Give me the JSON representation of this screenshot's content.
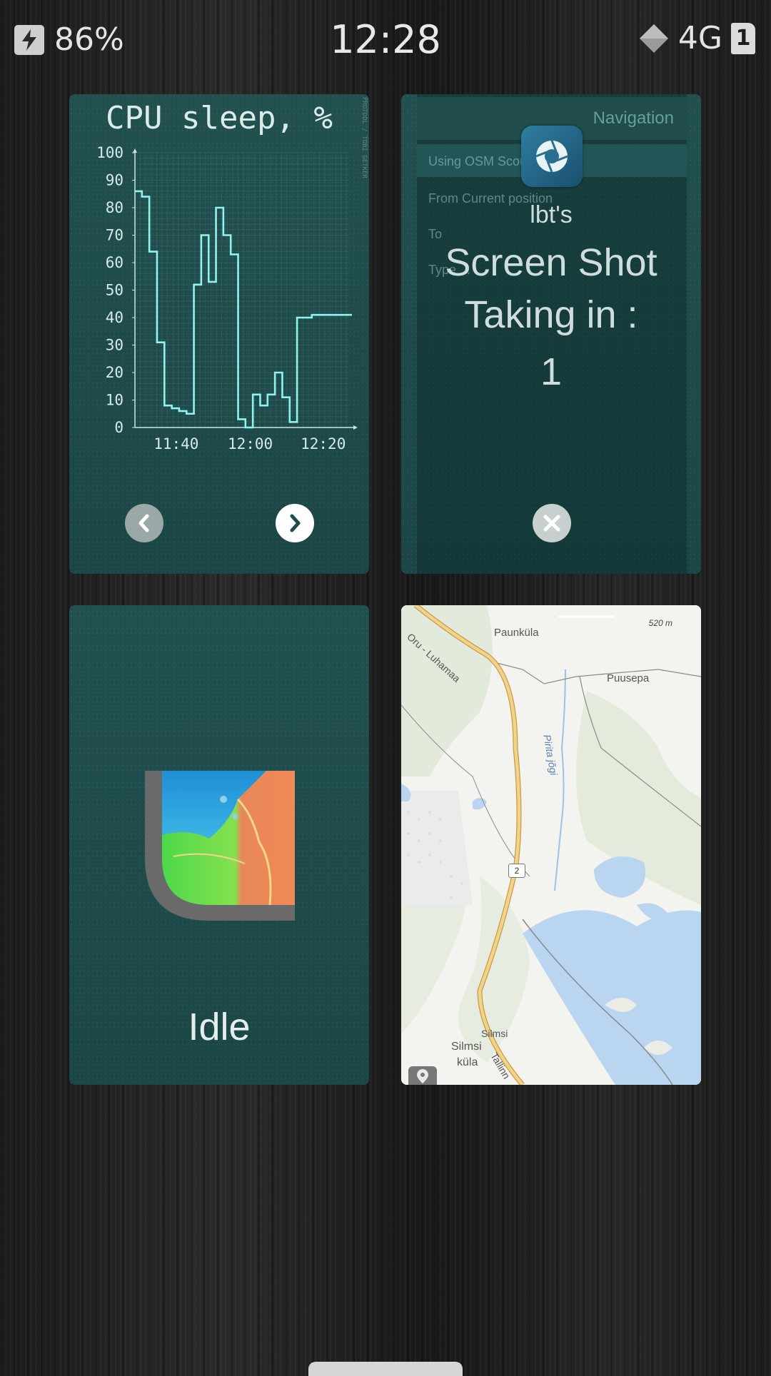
{
  "status_bar": {
    "battery_percent": "86%",
    "time": "12:28",
    "network_type": "4G",
    "sim_slot": "1",
    "icons": [
      "charging-bolt-icon",
      "signal-icon",
      "sim-card-icon"
    ]
  },
  "cards": {
    "cpu": {
      "title": "CPU sleep, %",
      "side_text": "PROTOOL / TOBI GETKER",
      "prev_icon": "chevron-left-icon",
      "next_icon": "chevron-right-icon"
    },
    "navigation": {
      "header": "Navigation",
      "using": "Using OSM Scout",
      "from": "From  Current position",
      "to": "To",
      "type": "Type ...",
      "overlay_owner": "lbt's",
      "overlay_line1": "Screen Shot",
      "overlay_line2": "Taking in :",
      "countdown": "1",
      "app_icon": "camera-shutter-icon",
      "close_icon": "close-icon"
    },
    "idle": {
      "status": "Idle",
      "app_icon": "weather-map-icon"
    },
    "map": {
      "scale": "520 m",
      "labels": {
        "paunkula": "Paunküla",
        "puusepa": "Puusepa",
        "oru_luhamaa": "Oru - Luhamaa",
        "pirita": "Pirita jõgi",
        "silmsi": "Silmsi",
        "silmsi_kula_1": "Silmsi",
        "silmsi_kula_2": "küla",
        "tallinn": "Tallinn"
      },
      "road_number": "2",
      "pin_icon": "location-pin-icon"
    }
  },
  "chart_data": {
    "type": "line",
    "step": true,
    "title": "CPU sleep, %",
    "xlabel": "",
    "ylabel": "",
    "x_ticks": [
      "11:40",
      "12:00",
      "12:20"
    ],
    "y_ticks": [
      0,
      10,
      20,
      30,
      40,
      50,
      60,
      70,
      80,
      90,
      100
    ],
    "ylim": [
      0,
      100
    ],
    "xlim_minutes": [
      11.7,
      70.6
    ],
    "series": [
      {
        "x_minutes": [
          11.7,
          13.6,
          15.6,
          17.7,
          19.7,
          21.7,
          23.7,
          25.7,
          27.7,
          29.7,
          31.7,
          33.7,
          35.7,
          37.7,
          39.7,
          41.7,
          43.7,
          45.7,
          47.7,
          49.7,
          51.7,
          53.7,
          55.7,
          57.7,
          59.7,
          61.7,
          63.7,
          65.7,
          67.7,
          69.7,
          70.6
        ],
        "values": [
          86,
          84,
          64,
          31,
          8,
          7,
          6,
          5,
          52,
          70,
          53,
          80,
          70,
          63,
          3,
          0,
          12,
          8,
          12,
          20,
          11,
          2,
          40,
          40,
          41,
          41,
          41,
          41,
          41,
          41,
          41
        ],
        "color": "#8ff3f0"
      }
    ],
    "grid": true,
    "legend": "none"
  },
  "colors": {
    "card_bg": "#1f4d4e",
    "chart_line": "#8ff3f0",
    "map_bg": "#eef0ec",
    "water": "#b9d5ef",
    "road": "#e9c47a"
  }
}
